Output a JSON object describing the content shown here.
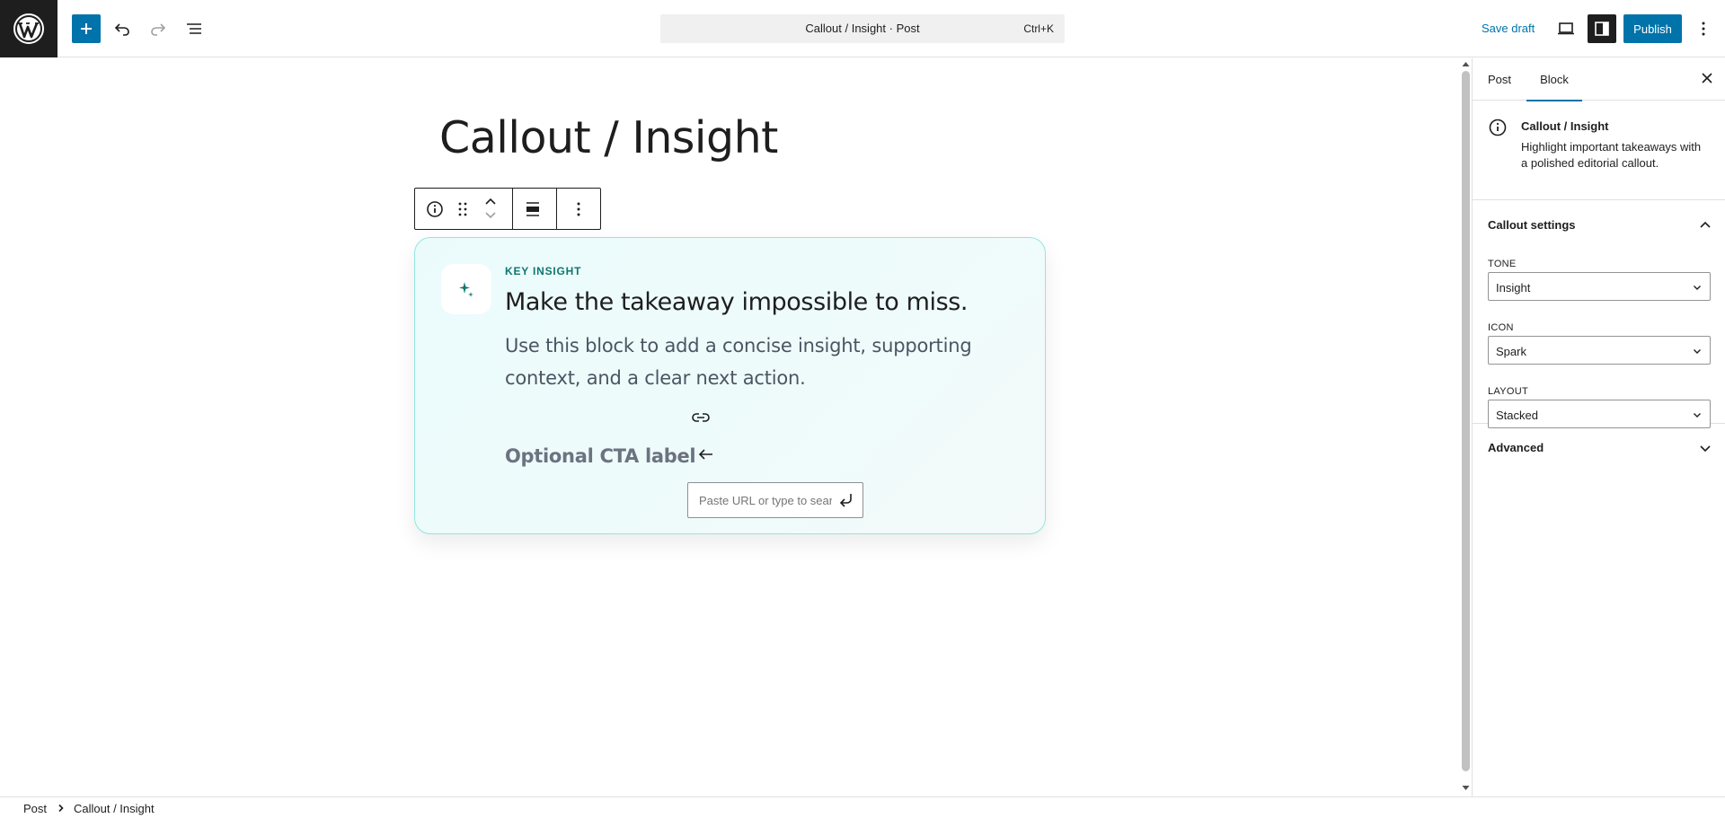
{
  "topbar": {
    "wordpress_logo_icon": "wordpress-logo-icon",
    "add_block_icon": "plus-icon",
    "undo_icon": "undo-icon",
    "redo_icon": "redo-icon",
    "document_overview_icon": "list-view-icon",
    "command_bar_title": "Callout / Insight · Post",
    "command_bar_shortcut": "Ctrl+K",
    "save_draft_label": "Save draft",
    "preview_icon": "desktop-icon",
    "settings_icon": "sidebar-toggle-icon",
    "publish_label": "Publish",
    "more_icon": "vertical-ellipsis-icon"
  },
  "editor": {
    "post_title": "Callout / Insight",
    "block_toolbar": {
      "block_info_icon": "info-icon",
      "drag_icon": "drag-handle-icon",
      "move_up_icon": "chevron-up-icon",
      "move_down_icon": "chevron-down-icon",
      "align_icon": "align-wide-icon",
      "options_icon": "vertical-ellipsis-icon"
    },
    "callout": {
      "icon": "spark-icon",
      "eyebrow": "KEY INSIGHT",
      "heading": "Make the takeaway impossible to miss.",
      "body": "Use this block to add a concise insight, supporting context, and a clear next action.",
      "link_icon": "link-icon",
      "cta_label": "Optional CTA label",
      "back_icon": "arrow-left-icon",
      "url_placeholder": "Paste URL or type to search",
      "url_value": "",
      "submit_icon": "enter-icon"
    }
  },
  "sidebar": {
    "tabs": [
      {
        "label": "Post",
        "active": false
      },
      {
        "label": "Block",
        "active": true
      }
    ],
    "close_icon": "close-icon",
    "block_card": {
      "icon": "info-icon",
      "title": "Callout / Insight",
      "description": "Highlight important takeaways with a polished editorial callout."
    },
    "callout_settings": {
      "title": "Callout settings",
      "expanded": true,
      "fields": [
        {
          "label": "TONE",
          "value": "Insight"
        },
        {
          "label": "ICON",
          "value": "Spark"
        },
        {
          "label": "LAYOUT",
          "value": "Stacked"
        }
      ]
    },
    "advanced": {
      "title": "Advanced",
      "expanded": false
    }
  },
  "breadcrumb": {
    "items": [
      "Post",
      "Callout / Insight"
    ],
    "separator_icon": "chevron-right-icon"
  },
  "colors": {
    "accent": "#0073aa",
    "dark": "#1e1e1e",
    "callout_border": "#93e5df",
    "callout_bg": "#ebfbfb",
    "eyebrow": "#0f766e"
  }
}
